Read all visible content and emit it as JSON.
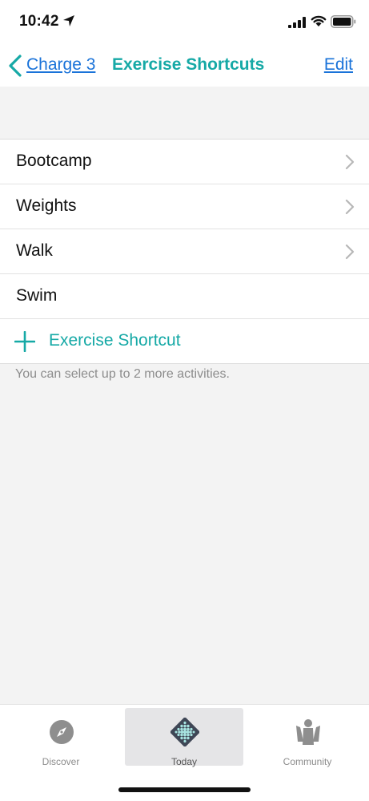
{
  "status": {
    "time": "10:42"
  },
  "nav": {
    "back_label": "Charge 3",
    "title": "Exercise Shortcuts",
    "edit_label": "Edit"
  },
  "shortcuts": [
    {
      "label": "Bootcamp",
      "has_chevron": true
    },
    {
      "label": "Weights",
      "has_chevron": true
    },
    {
      "label": "Walk",
      "has_chevron": true
    },
    {
      "label": "Swim",
      "has_chevron": false
    }
  ],
  "add_shortcut": {
    "label": "Exercise Shortcut",
    "icon": "plus-icon"
  },
  "hint": "You can select up to 2 more activities.",
  "tabs": [
    {
      "label": "Discover",
      "icon": "compass-icon",
      "active": false
    },
    {
      "label": "Today",
      "icon": "fitbit-dots-icon",
      "active": true
    },
    {
      "label": "Community",
      "icon": "community-icon",
      "active": false
    }
  ],
  "colors": {
    "accent": "#16a9a6",
    "link": "#1a73d9",
    "background": "#f3f3f3"
  }
}
